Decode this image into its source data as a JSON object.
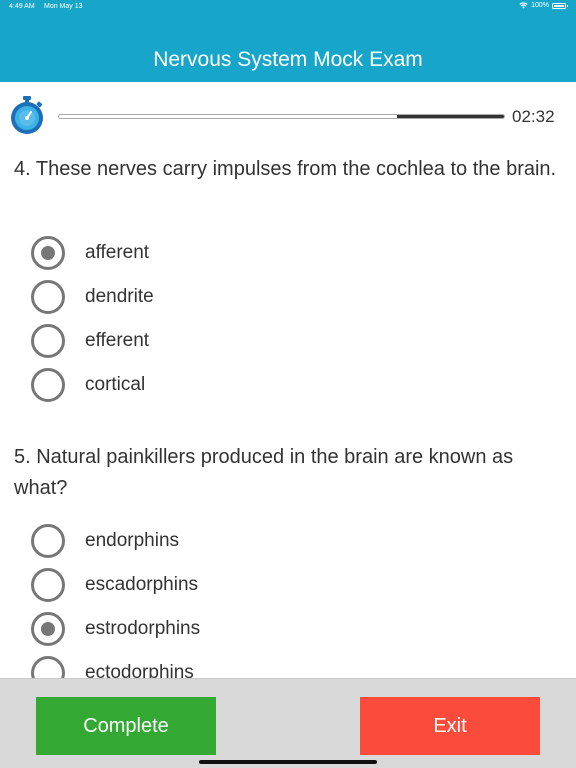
{
  "status_bar": {
    "time": "4:49 AM",
    "date": "Mon May 13",
    "battery": "100%"
  },
  "header": {
    "title": "Nervous System Mock Exam",
    "color": "#17a6c9"
  },
  "timer": {
    "remaining": "02:32",
    "progress_fraction": 0.76
  },
  "questions": [
    {
      "text": "4. These nerves carry impulses from the cochlea to the brain.",
      "options": [
        "afferent",
        "dendrite",
        "efferent",
        "cortical"
      ],
      "selected": 0
    },
    {
      "text": "5. Natural painkillers produced in the brain are known as what?",
      "options": [
        "endorphins",
        "escadorphins",
        "estrodorphins",
        "ectodorphins"
      ],
      "selected": 2
    }
  ],
  "footer": {
    "complete_label": "Complete",
    "exit_label": "Exit",
    "complete_color": "#33a832",
    "exit_color": "#fb4c3b"
  }
}
